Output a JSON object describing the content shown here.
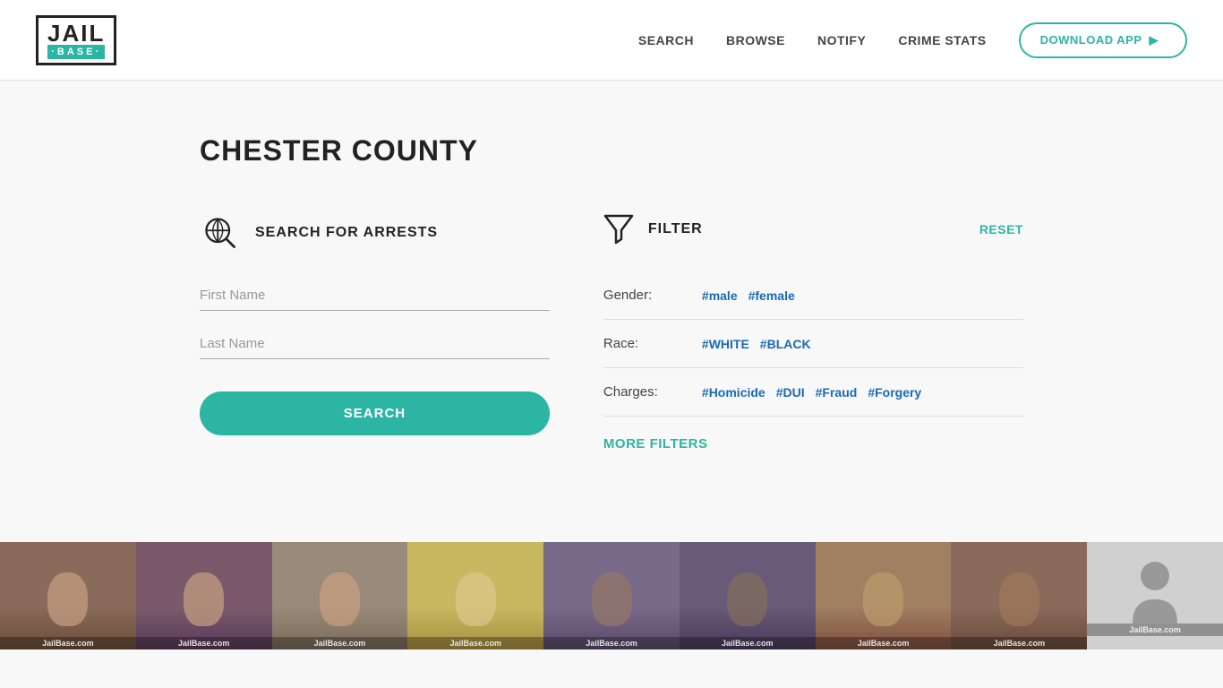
{
  "header": {
    "logo": {
      "jail": "JAIL",
      "base": "·BASE·"
    },
    "nav": {
      "search": "SEARCH",
      "browse": "BROWSE",
      "notify": "NOTIFY",
      "crime_stats": "CRIME STATS"
    },
    "download_btn": "DOWNLOAD APP"
  },
  "main": {
    "page_title": "CHESTER COUNTY",
    "search_section": {
      "icon_label": "search-globe-icon",
      "title": "SEARCH FOR ARRESTS",
      "first_name_placeholder": "First Name",
      "last_name_placeholder": "Last Name",
      "search_btn": "SEARCH"
    },
    "filter_section": {
      "title": "FILTER",
      "reset_btn": "RESET",
      "gender_label": "Gender:",
      "gender_tags": [
        "#male",
        "#female"
      ],
      "race_label": "Race:",
      "race_tags": [
        "#WHITE",
        "#BLACK"
      ],
      "charges_label": "Charges:",
      "charges_tags": [
        "#Homicide",
        "#DUI",
        "#Fraud",
        "#Forgery"
      ],
      "more_filters_btn": "MORE FILTERS"
    }
  },
  "photos": {
    "watermark": "JailBase.com",
    "count": 9
  }
}
